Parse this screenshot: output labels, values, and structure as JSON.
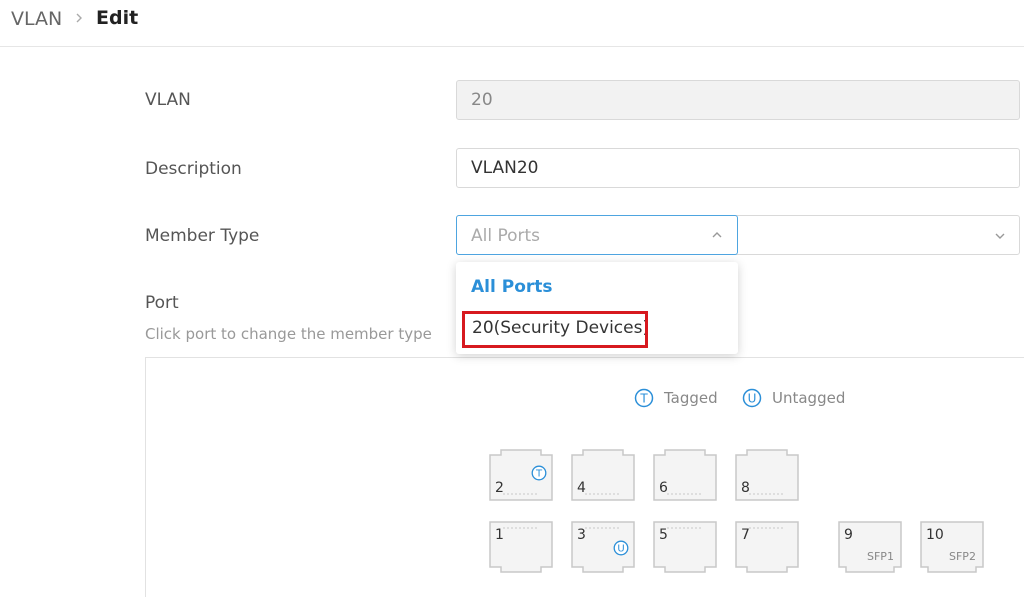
{
  "breadcrumb": {
    "root": "VLAN",
    "current": "Edit"
  },
  "form": {
    "vlan": {
      "label": "VLAN",
      "value": "20"
    },
    "description": {
      "label": "Description",
      "value": "VLAN20"
    },
    "member_type": {
      "label": "Member Type",
      "selected": "All Ports"
    },
    "port": {
      "label": "Port",
      "hint": "Click port to change the member type"
    }
  },
  "dropdown": {
    "options": [
      "All Ports",
      "20(Security Devices)"
    ]
  },
  "legend": {
    "tagged": {
      "glyph": "T",
      "label": "Tagged"
    },
    "untagged": {
      "glyph": "U",
      "label": "Untagged"
    }
  },
  "ports": {
    "p1": {
      "num": "1"
    },
    "p2": {
      "num": "2",
      "badge": "T"
    },
    "p3": {
      "num": "3",
      "badge": "U"
    },
    "p4": {
      "num": "4"
    },
    "p5": {
      "num": "5"
    },
    "p6": {
      "num": "6"
    },
    "p7": {
      "num": "7"
    },
    "p8": {
      "num": "8"
    },
    "p9": {
      "num": "9",
      "type": "SFP1"
    },
    "p10": {
      "num": "10",
      "type": "SFP2"
    }
  },
  "colors": {
    "accent": "#2b8fd8",
    "highlight": "#d7191f",
    "port_fill": "#f4f4f4",
    "port_stroke": "#c8c8c8"
  }
}
